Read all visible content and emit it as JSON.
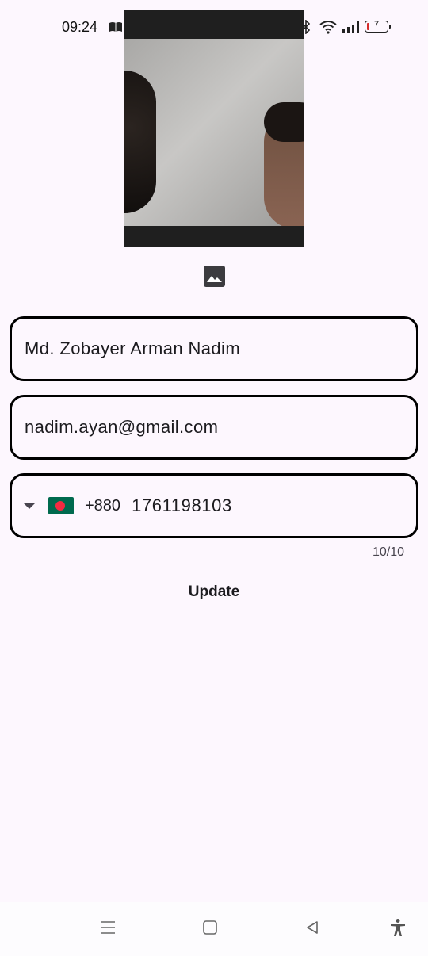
{
  "status_bar": {
    "time": "09:24",
    "battery_level": "7",
    "icons": [
      "book-icon",
      "gmail-icon",
      "bluetooth-icon",
      "wifi-icon",
      "signal-icon",
      "battery-icon"
    ]
  },
  "profile": {
    "photo_icon": "image-icon"
  },
  "form": {
    "name_value": "Md. Zobayer Arman Nadim",
    "email_value": "nadim.ayan@gmail.com",
    "country_flag": "bangladesh-flag",
    "dial_code": "+880",
    "phone_value": "1761198103",
    "phone_counter": "10/10",
    "update_label": "Update"
  },
  "nav": {
    "icons": [
      "menu-icon",
      "home-icon",
      "back-icon",
      "accessibility-icon"
    ]
  },
  "colors": {
    "background": "#fdf7fe",
    "field_border": "#000000",
    "text": "#1c1b1f",
    "battery_low": "#d62b2b",
    "flag_green": "#006a4e",
    "flag_red": "#f42a41"
  }
}
